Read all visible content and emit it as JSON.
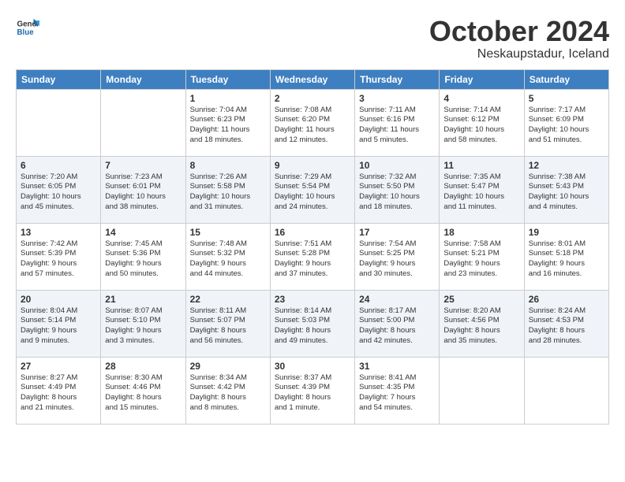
{
  "header": {
    "logo_general": "General",
    "logo_blue": "Blue",
    "month": "October 2024",
    "location": "Neskaupstadur, Iceland"
  },
  "weekdays": [
    "Sunday",
    "Monday",
    "Tuesday",
    "Wednesday",
    "Thursday",
    "Friday",
    "Saturday"
  ],
  "weeks": [
    [
      {
        "day": "",
        "info": ""
      },
      {
        "day": "",
        "info": ""
      },
      {
        "day": "1",
        "info": "Sunrise: 7:04 AM\nSunset: 6:23 PM\nDaylight: 11 hours\nand 18 minutes."
      },
      {
        "day": "2",
        "info": "Sunrise: 7:08 AM\nSunset: 6:20 PM\nDaylight: 11 hours\nand 12 minutes."
      },
      {
        "day": "3",
        "info": "Sunrise: 7:11 AM\nSunset: 6:16 PM\nDaylight: 11 hours\nand 5 minutes."
      },
      {
        "day": "4",
        "info": "Sunrise: 7:14 AM\nSunset: 6:12 PM\nDaylight: 10 hours\nand 58 minutes."
      },
      {
        "day": "5",
        "info": "Sunrise: 7:17 AM\nSunset: 6:09 PM\nDaylight: 10 hours\nand 51 minutes."
      }
    ],
    [
      {
        "day": "6",
        "info": "Sunrise: 7:20 AM\nSunset: 6:05 PM\nDaylight: 10 hours\nand 45 minutes."
      },
      {
        "day": "7",
        "info": "Sunrise: 7:23 AM\nSunset: 6:01 PM\nDaylight: 10 hours\nand 38 minutes."
      },
      {
        "day": "8",
        "info": "Sunrise: 7:26 AM\nSunset: 5:58 PM\nDaylight: 10 hours\nand 31 minutes."
      },
      {
        "day": "9",
        "info": "Sunrise: 7:29 AM\nSunset: 5:54 PM\nDaylight: 10 hours\nand 24 minutes."
      },
      {
        "day": "10",
        "info": "Sunrise: 7:32 AM\nSunset: 5:50 PM\nDaylight: 10 hours\nand 18 minutes."
      },
      {
        "day": "11",
        "info": "Sunrise: 7:35 AM\nSunset: 5:47 PM\nDaylight: 10 hours\nand 11 minutes."
      },
      {
        "day": "12",
        "info": "Sunrise: 7:38 AM\nSunset: 5:43 PM\nDaylight: 10 hours\nand 4 minutes."
      }
    ],
    [
      {
        "day": "13",
        "info": "Sunrise: 7:42 AM\nSunset: 5:39 PM\nDaylight: 9 hours\nand 57 minutes."
      },
      {
        "day": "14",
        "info": "Sunrise: 7:45 AM\nSunset: 5:36 PM\nDaylight: 9 hours\nand 50 minutes."
      },
      {
        "day": "15",
        "info": "Sunrise: 7:48 AM\nSunset: 5:32 PM\nDaylight: 9 hours\nand 44 minutes."
      },
      {
        "day": "16",
        "info": "Sunrise: 7:51 AM\nSunset: 5:28 PM\nDaylight: 9 hours\nand 37 minutes."
      },
      {
        "day": "17",
        "info": "Sunrise: 7:54 AM\nSunset: 5:25 PM\nDaylight: 9 hours\nand 30 minutes."
      },
      {
        "day": "18",
        "info": "Sunrise: 7:58 AM\nSunset: 5:21 PM\nDaylight: 9 hours\nand 23 minutes."
      },
      {
        "day": "19",
        "info": "Sunrise: 8:01 AM\nSunset: 5:18 PM\nDaylight: 9 hours\nand 16 minutes."
      }
    ],
    [
      {
        "day": "20",
        "info": "Sunrise: 8:04 AM\nSunset: 5:14 PM\nDaylight: 9 hours\nand 9 minutes."
      },
      {
        "day": "21",
        "info": "Sunrise: 8:07 AM\nSunset: 5:10 PM\nDaylight: 9 hours\nand 3 minutes."
      },
      {
        "day": "22",
        "info": "Sunrise: 8:11 AM\nSunset: 5:07 PM\nDaylight: 8 hours\nand 56 minutes."
      },
      {
        "day": "23",
        "info": "Sunrise: 8:14 AM\nSunset: 5:03 PM\nDaylight: 8 hours\nand 49 minutes."
      },
      {
        "day": "24",
        "info": "Sunrise: 8:17 AM\nSunset: 5:00 PM\nDaylight: 8 hours\nand 42 minutes."
      },
      {
        "day": "25",
        "info": "Sunrise: 8:20 AM\nSunset: 4:56 PM\nDaylight: 8 hours\nand 35 minutes."
      },
      {
        "day": "26",
        "info": "Sunrise: 8:24 AM\nSunset: 4:53 PM\nDaylight: 8 hours\nand 28 minutes."
      }
    ],
    [
      {
        "day": "27",
        "info": "Sunrise: 8:27 AM\nSunset: 4:49 PM\nDaylight: 8 hours\nand 21 minutes."
      },
      {
        "day": "28",
        "info": "Sunrise: 8:30 AM\nSunset: 4:46 PM\nDaylight: 8 hours\nand 15 minutes."
      },
      {
        "day": "29",
        "info": "Sunrise: 8:34 AM\nSunset: 4:42 PM\nDaylight: 8 hours\nand 8 minutes."
      },
      {
        "day": "30",
        "info": "Sunrise: 8:37 AM\nSunset: 4:39 PM\nDaylight: 8 hours\nand 1 minute."
      },
      {
        "day": "31",
        "info": "Sunrise: 8:41 AM\nSunset: 4:35 PM\nDaylight: 7 hours\nand 54 minutes."
      },
      {
        "day": "",
        "info": ""
      },
      {
        "day": "",
        "info": ""
      }
    ]
  ]
}
